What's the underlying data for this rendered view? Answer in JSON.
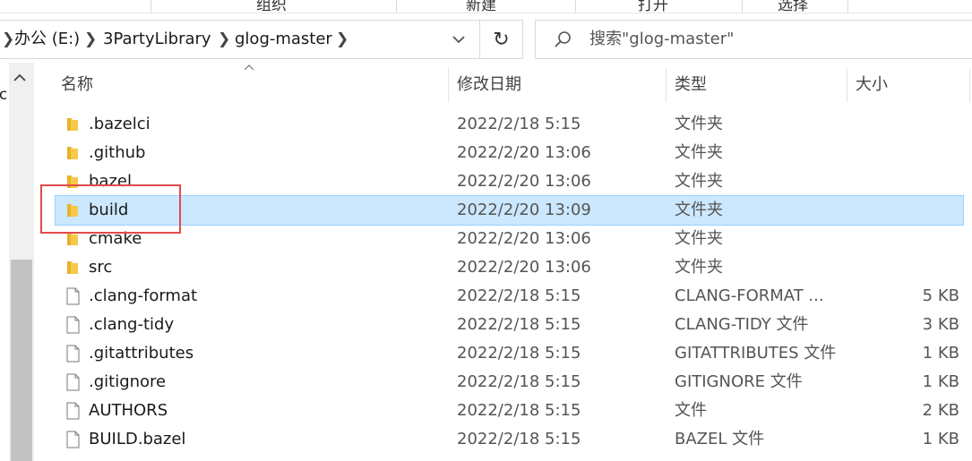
{
  "ribbon": {
    "groups": [
      "组织",
      "新建",
      "打开",
      "选择"
    ]
  },
  "address": {
    "breadcrumbs": [
      "办公 (E:)",
      "3PartyLibrary",
      "glog-master"
    ],
    "search_placeholder": "搜索\"glog-master\""
  },
  "nav_pane": {
    "partial_text": "sc"
  },
  "columns": {
    "name": "名称",
    "date": "修改日期",
    "type": "类型",
    "size": "大小"
  },
  "files": [
    {
      "name": ".bazelci",
      "date": "2022/2/18 5:15",
      "type": "文件夹",
      "size": "",
      "kind": "folder-icon"
    },
    {
      "name": ".github",
      "date": "2022/2/20 13:06",
      "type": "文件夹",
      "size": "",
      "kind": "folder-icon"
    },
    {
      "name": "bazel",
      "date": "2022/2/20 13:06",
      "type": "文件夹",
      "size": "",
      "kind": "folder-icon"
    },
    {
      "name": "build",
      "date": "2022/2/20 13:09",
      "type": "文件夹",
      "size": "",
      "kind": "folder-icon",
      "selected": true
    },
    {
      "name": "cmake",
      "date": "2022/2/20 13:06",
      "type": "文件夹",
      "size": "",
      "kind": "folder-icon"
    },
    {
      "name": "src",
      "date": "2022/2/20 13:06",
      "type": "文件夹",
      "size": "",
      "kind": "folder-icon"
    },
    {
      "name": ".clang-format",
      "date": "2022/2/18 5:15",
      "type": "CLANG-FORMAT ...",
      "size": "5 KB",
      "kind": "file-icon"
    },
    {
      "name": ".clang-tidy",
      "date": "2022/2/18 5:15",
      "type": "CLANG-TIDY 文件",
      "size": "3 KB",
      "kind": "file-icon"
    },
    {
      "name": ".gitattributes",
      "date": "2022/2/18 5:15",
      "type": "GITATTRIBUTES 文件",
      "size": "1 KB",
      "kind": "file-icon"
    },
    {
      "name": ".gitignore",
      "date": "2022/2/18 5:15",
      "type": "GITIGNORE 文件",
      "size": "1 KB",
      "kind": "file-icon"
    },
    {
      "name": "AUTHORS",
      "date": "2022/2/18 5:15",
      "type": "文件",
      "size": "2 KB",
      "kind": "file-icon"
    },
    {
      "name": "BUILD.bazel",
      "date": "2022/2/18 5:15",
      "type": "BAZEL 文件",
      "size": "1 KB",
      "kind": "file-icon"
    }
  ],
  "colors": {
    "selection": "#cce8ff",
    "selection_border": "#99d1ff",
    "folder": "#f7c948",
    "annotation": "#e24a4a"
  }
}
